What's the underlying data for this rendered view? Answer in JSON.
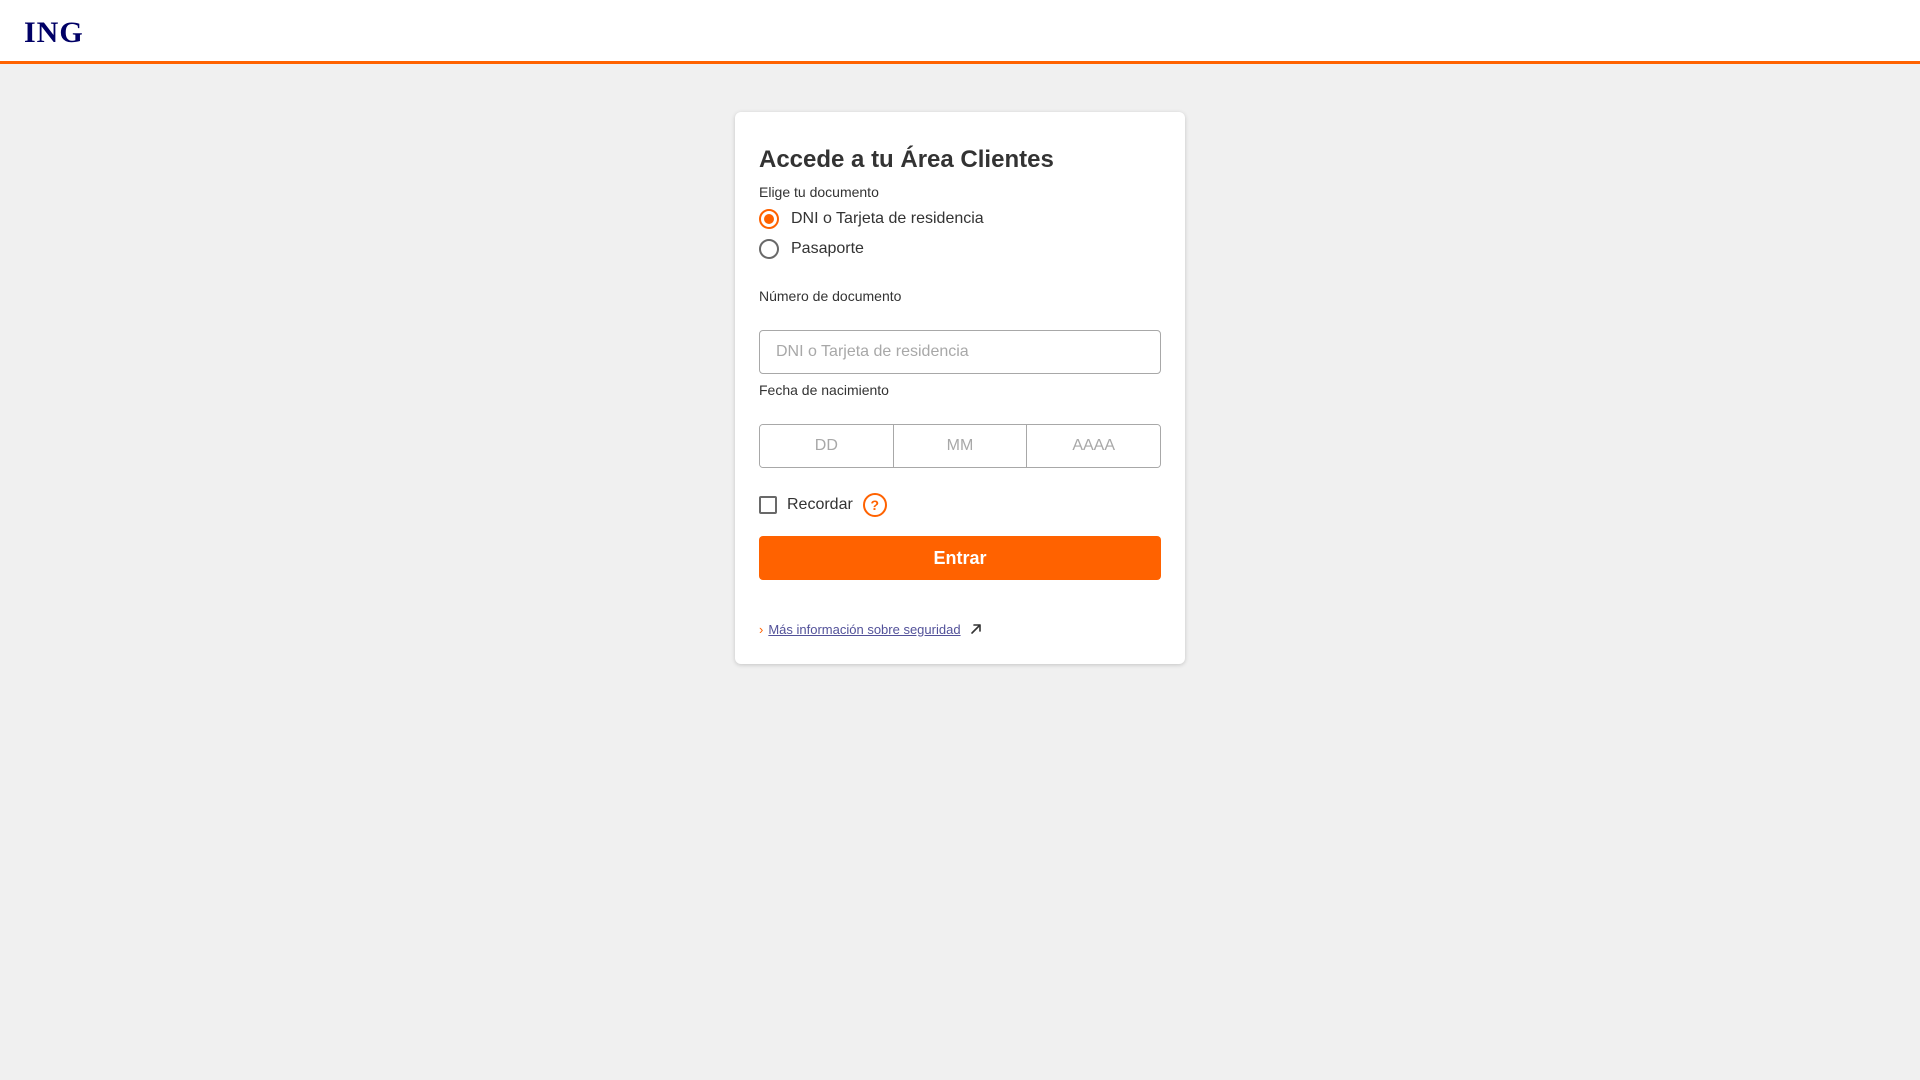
{
  "header": {
    "logo_text": "ING",
    "accent_color": "#ff6200"
  },
  "login": {
    "title": "Accede a tu Área Clientes",
    "document_type": {
      "label": "Elige tu documento",
      "options": [
        {
          "label": "DNI o Tarjeta de residencia",
          "selected": true
        },
        {
          "label": "Pasaporte",
          "selected": false
        }
      ]
    },
    "document_number": {
      "label": "Número de documento",
      "value": "",
      "placeholder": "DNI o Tarjeta de residencia"
    },
    "birth_date": {
      "label": "Fecha de nacimiento",
      "day_placeholder": "DD",
      "month_placeholder": "MM",
      "year_placeholder": "AAAA"
    },
    "remember": {
      "label": "Recordar",
      "checked": false,
      "help_icon": "question-circle-icon",
      "help_glyph": "?"
    },
    "submit_label": "Entrar",
    "security_link": {
      "chevron": "›",
      "label": "Más información sobre seguridad",
      "icon": "external-link-icon"
    }
  }
}
